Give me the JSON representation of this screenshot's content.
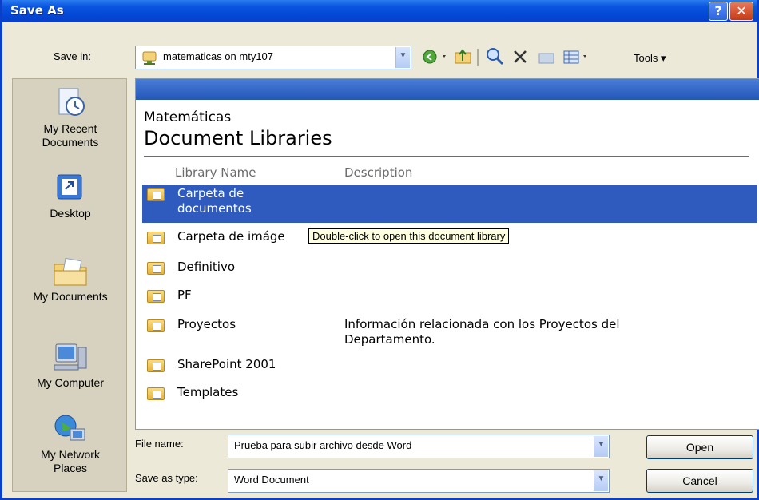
{
  "window": {
    "title": "Save As",
    "help_glyph": "?",
    "close_glyph": "✕"
  },
  "toolbar": {
    "save_in_label": "Save in:",
    "save_in_value": "matematicas on mty107",
    "tools_label": "Tools ▾",
    "icons": [
      "back-icon",
      "up-folder-icon",
      "search-web-icon",
      "delete-icon",
      "new-folder-icon",
      "views-icon"
    ]
  },
  "places": [
    {
      "label": "My Recent\nDocuments",
      "icon": "recent-documents-icon"
    },
    {
      "label": "Desktop",
      "icon": "desktop-icon"
    },
    {
      "label": "My Documents",
      "icon": "my-documents-icon"
    },
    {
      "label": "My Computer",
      "icon": "my-computer-icon"
    },
    {
      "label": "My Network\nPlaces",
      "icon": "network-places-icon"
    }
  ],
  "content": {
    "site_name": "Matemáticas",
    "heading": "Document Libraries",
    "columns": [
      "Library Name",
      "Description"
    ],
    "libraries": [
      {
        "name": "Carpeta de\ndocumentos",
        "description": ""
      },
      {
        "name": "Carpeta de imáge",
        "description": ""
      },
      {
        "name": "Definitivo",
        "description": ""
      },
      {
        "name": "PF",
        "description": ""
      },
      {
        "name": "Proyectos",
        "description": "Información relacionada con los Proyectos del Departamento."
      },
      {
        "name": "SharePoint 2001",
        "description": ""
      },
      {
        "name": "Templates",
        "description": ""
      }
    ],
    "tooltip": "Double-click to open this document library"
  },
  "form": {
    "file_name_label": "File name:",
    "file_name_value": "Prueba para subir archivo desde Word",
    "save_type_label": "Save as type:",
    "save_type_value": "Word Document",
    "open_button": "Open",
    "cancel_button": "Cancel"
  },
  "colors": {
    "title_bar": "#0a55e0",
    "selection": "#2f5bbf",
    "dialog_bg": "#ece9d8"
  }
}
